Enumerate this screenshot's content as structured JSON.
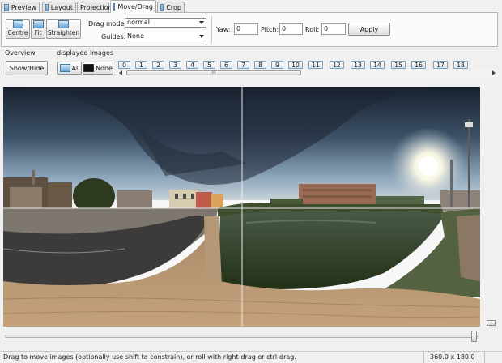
{
  "tabs": [
    {
      "label": "Preview",
      "icon": "preview-icon",
      "active": false
    },
    {
      "label": "Layout",
      "icon": "layout-icon",
      "active": false
    },
    {
      "label": "Projection",
      "icon": "projection-icon",
      "active": false
    },
    {
      "label": "Move/Drag",
      "icon": "move-drag-icon",
      "active": true
    },
    {
      "label": "Crop",
      "icon": "crop-icon",
      "active": false
    }
  ],
  "toolbar": {
    "centre_label": "Centre",
    "fit_label": "Fit",
    "straighten_label": "Straighten",
    "drag_mode_label": "Drag mode:",
    "drag_mode_value": "normal",
    "guides_label": "Guides:",
    "guides_value": "None",
    "yaw_label": "Yaw:",
    "yaw_value": "0",
    "pitch_label": "Pitch:",
    "pitch_value": "0",
    "roll_label": "Roll:",
    "roll_value": "0",
    "apply_label": "Apply"
  },
  "overview": {
    "label": "Overview",
    "show_hide_label": "Show/Hide"
  },
  "displayed_images": {
    "label": "displayed images",
    "all_label": "All",
    "none_label": "None",
    "numbers": [
      "0",
      "1",
      "2",
      "3",
      "4",
      "5",
      "6",
      "7",
      "8",
      "9",
      "10",
      "11",
      "12",
      "13",
      "14",
      "15",
      "16",
      "17",
      "18"
    ],
    "scroll_grip": "III"
  },
  "status": {
    "message": "Drag to move images (optionally use shift to constrain), or roll with right-drag or ctrl-drag.",
    "projection_size": "360.0 x 180.0"
  },
  "colors": {
    "accent": "#6a9cc8",
    "panel_border": "#b5b5b5",
    "sky_top": "#1b2433",
    "water": "#2b3a22"
  }
}
